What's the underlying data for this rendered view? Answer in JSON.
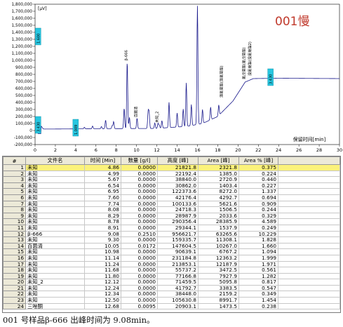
{
  "chart_data": {
    "type": "line",
    "title": "",
    "overlay_label": "001慢",
    "x_axis_label": "保留时间[min]",
    "xlim": [
      0,
      30
    ],
    "ylim": [
      -200000,
      1800000
    ],
    "x_ticks": [
      "0",
      "2",
      "4",
      "6",
      "8",
      "10",
      "12",
      "14",
      "16",
      "18",
      "20",
      "22",
      "24",
      "26",
      "28",
      "30"
    ],
    "y_ticks": [
      "-200,000",
      "-100,000",
      "0",
      "100,000",
      "200,000",
      "300,000",
      "400,000",
      "500,000",
      "600,000",
      "700,000",
      "800,000",
      "900,000",
      "1,000,000",
      "1,100,000",
      "1,200,000",
      "1,300,000",
      "1,400,000",
      "1,500,000",
      "1,600,000",
      "1,700,000",
      "1,800,000"
    ],
    "y_unit": "[μV]",
    "trace_color": "#1a1a8c",
    "peaks": [
      {
        "x": 0.6,
        "y": 40000,
        "w": 0.1
      },
      {
        "x": 4.86,
        "y": 21822,
        "w": 0.05
      },
      {
        "x": 5.67,
        "y": 38840,
        "w": 0.05
      },
      {
        "x": 6.54,
        "y": 30862,
        "w": 0.05
      },
      {
        "x": 6.95,
        "y": 122374,
        "w": 0.05
      },
      {
        "x": 7.6,
        "y": 42176,
        "w": 0.05
      },
      {
        "x": 7.74,
        "y": 100134,
        "w": 0.05
      },
      {
        "x": 8.78,
        "y": 290356,
        "w": 0.05
      },
      {
        "x": 9.08,
        "y": 956621,
        "w": 0.05
      },
      {
        "x": 9.3,
        "y": 159335,
        "w": 0.05
      },
      {
        "x": 10.05,
        "y": 147605,
        "w": 0.05
      },
      {
        "x": 11.14,
        "y": 231184,
        "w": 0.05
      },
      {
        "x": 11.24,
        "y": 213853,
        "w": 0.05
      },
      {
        "x": 11.8,
        "y": 77167,
        "w": 0.05
      },
      {
        "x": 12.12,
        "y": 71460,
        "w": 0.05
      },
      {
        "x": 12.24,
        "y": 41793,
        "w": 0.05
      },
      {
        "x": 12.5,
        "y": 105631,
        "w": 0.05
      },
      {
        "x": 13.2,
        "y": 360000,
        "w": 0.05
      },
      {
        "x": 14.0,
        "y": 200000,
        "w": 0.05
      },
      {
        "x": 14.6,
        "y": 250000,
        "w": 0.05
      },
      {
        "x": 14.9,
        "y": 620000,
        "w": 0.05
      },
      {
        "x": 15.4,
        "y": 300000,
        "w": 0.05
      },
      {
        "x": 16.0,
        "y": 1690000,
        "w": 0.05
      },
      {
        "x": 16.5,
        "y": 200000,
        "w": 0.05
      },
      {
        "x": 17.3,
        "y": 180000,
        "w": 0.05
      },
      {
        "x": 18.1,
        "y": 150000,
        "w": 0.05
      }
    ],
    "baseline": [
      [
        0,
        20000
      ],
      [
        12,
        30000
      ],
      [
        15,
        60000
      ],
      [
        16.5,
        100000
      ],
      [
        18,
        200000
      ],
      [
        19.5,
        420000
      ],
      [
        20.7,
        690000
      ],
      [
        21.5,
        740000
      ],
      [
        24,
        745000
      ],
      [
        30,
        740000
      ]
    ],
    "peak_labels": [
      {
        "x": 9.08,
        "y": 956621,
        "text": "β-666"
      },
      {
        "x": 10.05,
        "y": 147605,
        "text": "百菌清"
      },
      {
        "x": 12.12,
        "y": 71460,
        "text": "未知_2"
      },
      {
        "x": 18.5,
        "y": 430000,
        "text": "溴氰菊酯(溴氰菊酯)"
      },
      {
        "x": 20.7,
        "y": 690000,
        "text": "氰戊菊酯(氰戊菊酯)"
      },
      {
        "x": 21.3,
        "y": 740000,
        "text": "溴氰菊酯(溴氰菊酯2)"
      }
    ],
    "cyan_markers": [
      {
        "x": 0.3,
        "y": 1340000,
        "text": "1.600"
      },
      {
        "x": 0.3,
        "y": 80000,
        "text": "3.430"
      },
      {
        "x": 4.0,
        "y": 40000,
        "text": "1.009"
      },
      {
        "x": 23.2,
        "y": 760000,
        "text": "3.430"
      }
    ]
  },
  "table": {
    "headers": [
      "#",
      "文件名",
      "时间 [Min]",
      "数量 [g/l]",
      "高度 [峰]",
      "Area [峰]",
      "Area % [峰]"
    ],
    "rows": [
      [
        "1",
        "未知",
        "4.86",
        "0.0000",
        "21821.8",
        "2321.8",
        "0.375"
      ],
      [
        "2",
        "未知",
        "4.99",
        "0.0000",
        "22192.4",
        "1385.0",
        "0.224"
      ],
      [
        "3",
        "未知",
        "5.67",
        "0.0000",
        "38840.0",
        "2720.9",
        "0.440"
      ],
      [
        "4",
        "未知",
        "6.54",
        "0.0000",
        "30862.0",
        "1403.4",
        "0.227"
      ],
      [
        "5",
        "未知",
        "6.95",
        "0.0000",
        "122373.6",
        "8272.0",
        "1.337"
      ],
      [
        "6",
        "未知",
        "7.60",
        "0.0000",
        "42176.4",
        "4292.7",
        "0.694"
      ],
      [
        "7",
        "未知",
        "7.74",
        "0.0000",
        "100133.6",
        "5621.6",
        "0.909"
      ],
      [
        "8",
        "未知",
        "8.08",
        "0.0000",
        "24718.3",
        "1506.5",
        "0.244"
      ],
      [
        "9",
        "未知",
        "8.29",
        "0.0000",
        "28987.9",
        "2033.6",
        "0.329"
      ],
      [
        "10",
        "未知",
        "8.78",
        "0.0000",
        "290356.4",
        "28385.9",
        "4.589"
      ],
      [
        "11",
        "未知",
        "8.91",
        "0.0000",
        "29344.1",
        "1537.9",
        "0.249"
      ],
      [
        "12",
        "β-666",
        "9.08",
        "0.2510",
        "956621.7",
        "63265.6",
        "10.229"
      ],
      [
        "13",
        "未知",
        "9.30",
        "0.0000",
        "159335.7",
        "11308.1",
        "1.828"
      ],
      [
        "14",
        "百菌清",
        "10.05",
        "0.0172",
        "147604.5",
        "10267.0",
        "1.660"
      ],
      [
        "15",
        "未知",
        "10.98",
        "0.0000",
        "90639.1",
        "6767.2",
        "1.094"
      ],
      [
        "16",
        "未知",
        "11.14",
        "0.0000",
        "231184.8",
        "12363.2",
        "1.999"
      ],
      [
        "17",
        "未知",
        "11.24",
        "0.0000",
        "213853.1",
        "12187.9",
        "1.971"
      ],
      [
        "18",
        "未知",
        "11.68",
        "0.0000",
        "55737.2",
        "3472.5",
        "0.561"
      ],
      [
        "19",
        "未知",
        "11.80",
        "0.0000",
        "77166.8",
        "7927.9",
        "1.282"
      ],
      [
        "20",
        "未知_2",
        "12.12",
        "0.0000",
        "71459.5",
        "5095.8",
        "0.817"
      ],
      [
        "21",
        "未知",
        "12.24",
        "0.0000",
        "41792.7",
        "3383.5",
        "0.547"
      ],
      [
        "22",
        "未知",
        "12.34",
        "0.0000",
        "38448.0",
        "2159.2",
        "0.349"
      ],
      [
        "23",
        "未知",
        "12.50",
        "0.0000",
        "105630.8",
        "8991.7",
        "1.454"
      ],
      [
        "24",
        "三唑酮",
        "12.68",
        "0.0095",
        "20903.1",
        "1473.5",
        "0.238"
      ]
    ]
  },
  "caption": "001 号样品β-666 出峰时间为 9.08min。"
}
